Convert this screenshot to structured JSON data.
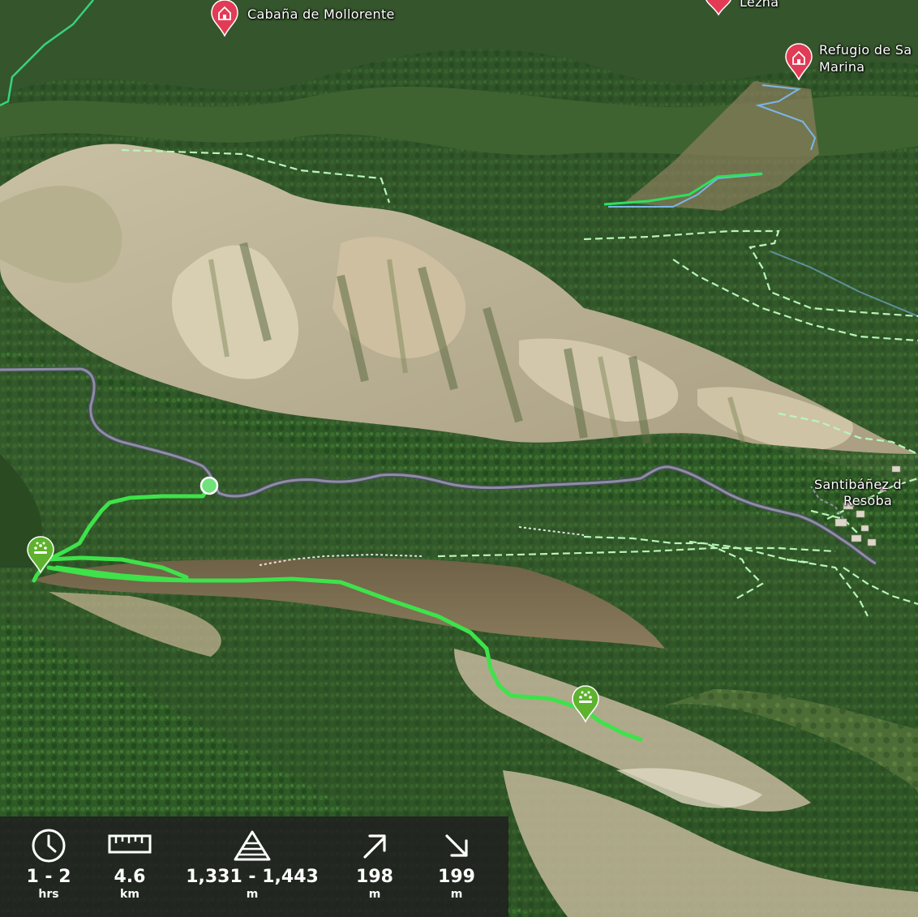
{
  "map": {
    "pois": [
      {
        "label_lines": [
          "Cabaña de Mollorente"
        ],
        "icon": "mountain-hut-icon"
      },
      {
        "label_lines": [
          "Lezna"
        ],
        "icon": "mountain-hut-icon"
      },
      {
        "label_lines": [
          "Refugio de Sa",
          "Marina"
        ],
        "icon": "mountain-hut-icon"
      }
    ],
    "village_label_lines": [
      "Santibáñez d",
      "Resoba"
    ],
    "waypoint_icons": [
      "start-waypoint-pin",
      "viewpoint-marker-icon",
      "viewpoint-marker-icon"
    ],
    "colors": {
      "track": "#3ee24a",
      "road": "#6d7182",
      "trail": "#b8f5b8",
      "hut_pin": "#e23b55",
      "stream": "#7ab6e6"
    }
  },
  "stats": {
    "duration": {
      "icon": "clock-icon",
      "value": "1 - 2",
      "unit": "hrs"
    },
    "distance": {
      "icon": "ruler-icon",
      "value": "4.6",
      "unit": "km"
    },
    "elevation_range": {
      "icon": "elevation-triangle-icon",
      "value": "1,331 - 1,443",
      "unit": "m"
    },
    "ascent": {
      "icon": "arrow-up-right-icon",
      "value": "198",
      "unit": "m"
    },
    "descent": {
      "icon": "arrow-down-right-icon",
      "value": "199",
      "unit": "m"
    }
  }
}
